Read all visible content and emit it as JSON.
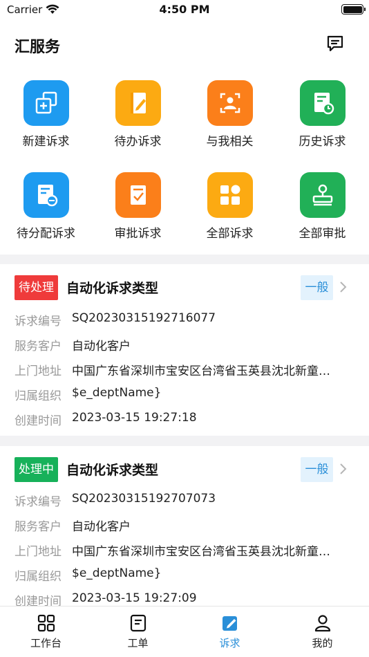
{
  "status_bar": {
    "carrier": "Carrier",
    "time": "4:50 PM"
  },
  "header": {
    "title": "汇服务",
    "message_icon": "message-square-icon"
  },
  "services": [
    {
      "label": "新建诉求",
      "icon": "new-request-icon",
      "color": "#1e9bf0"
    },
    {
      "label": "待办诉求",
      "icon": "todo-edit-icon",
      "color": "#fcaa12"
    },
    {
      "label": "与我相关",
      "icon": "person-scan-icon",
      "color": "#fb7f1a"
    },
    {
      "label": "历史诉求",
      "icon": "history-doc-icon",
      "color": "#21b057"
    },
    {
      "label": "待分配诉求",
      "icon": "assign-doc-icon",
      "color": "#1e9bf0"
    },
    {
      "label": "审批诉求",
      "icon": "approve-check-icon",
      "color": "#fb7f1a"
    },
    {
      "label": "全部诉求",
      "icon": "grid-apps-icon",
      "color": "#fcaa12"
    },
    {
      "label": "全部审批",
      "icon": "stamp-icon",
      "color": "#21b057"
    }
  ],
  "labels": {
    "number": "诉求编号",
    "customer": "服务客户",
    "address": "上门地址",
    "org": "归属组织",
    "created": "创建时间"
  },
  "requests": [
    {
      "status": "待处理",
      "status_color": "#ef3b3b",
      "title": "自动化诉求类型",
      "level": "一般",
      "number": "SQ20230315192716077",
      "customer": "自动化客户",
      "address": "中国广东省深圳市宝安区台湾省玉英县沈北新童…",
      "org": "$e_deptName}",
      "created": "2023-03-15 19:27:18"
    },
    {
      "status": "处理中",
      "status_color": "#17b15a",
      "title": "自动化诉求类型",
      "level": "一般",
      "number": "SQ20230315192707073",
      "customer": "自动化客户",
      "address": "中国广东省深圳市宝安区台湾省玉英县沈北新童…",
      "org": "$e_deptName}",
      "created": "2023-03-15 19:27:09"
    }
  ],
  "tabs": [
    {
      "label": "工作台",
      "icon": "workbench-grid-icon"
    },
    {
      "label": "工单",
      "icon": "work-order-icon"
    },
    {
      "label": "诉求",
      "icon": "request-edit-icon",
      "active": true
    },
    {
      "label": "我的",
      "icon": "profile-person-icon"
    }
  ],
  "colors": {
    "accent": "#2a8fd8",
    "level_bg": "#e3f2fd"
  }
}
